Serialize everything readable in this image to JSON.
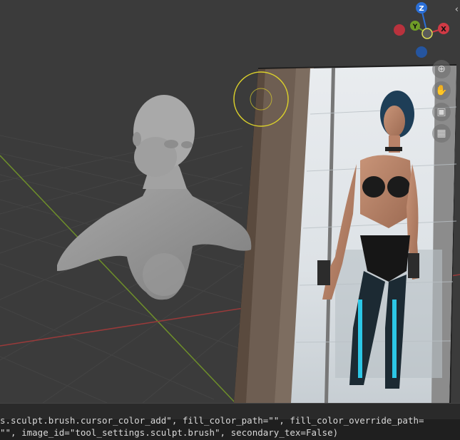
{
  "gizmo": {
    "z_label": "Z",
    "y_label": "Y",
    "x_label": "X",
    "colors": {
      "z": "#2b6fd6",
      "y": "#6f9c27",
      "x": "#d03a45",
      "neg_x": "#b9323d",
      "neg_z": "#25559f"
    }
  },
  "nav_icons": [
    "zoom-icon",
    "hand-pan-icon",
    "camera-icon",
    "perspective-grid-icon"
  ],
  "nav_glyphs": {
    "zoom": "⊕",
    "pan": "✋",
    "camera": "▣",
    "grid": "▦"
  },
  "collapse_glyph": "‹",
  "console": {
    "line1": "s.sculpt.brush.cursor_color_add\", fill_color_path=\"\", fill_color_override_path=",
    "line2": "\"\", image_id=\"tool_settings.sculpt.brush\", secondary_tex=False)"
  },
  "colors": {
    "viewport_bg": "#3b3b3b",
    "x_axis": "#9a3a3a",
    "y_axis": "#6e8f2a",
    "brush_cursor": "#d9cf2b",
    "console_bg": "#1f1f1f"
  }
}
